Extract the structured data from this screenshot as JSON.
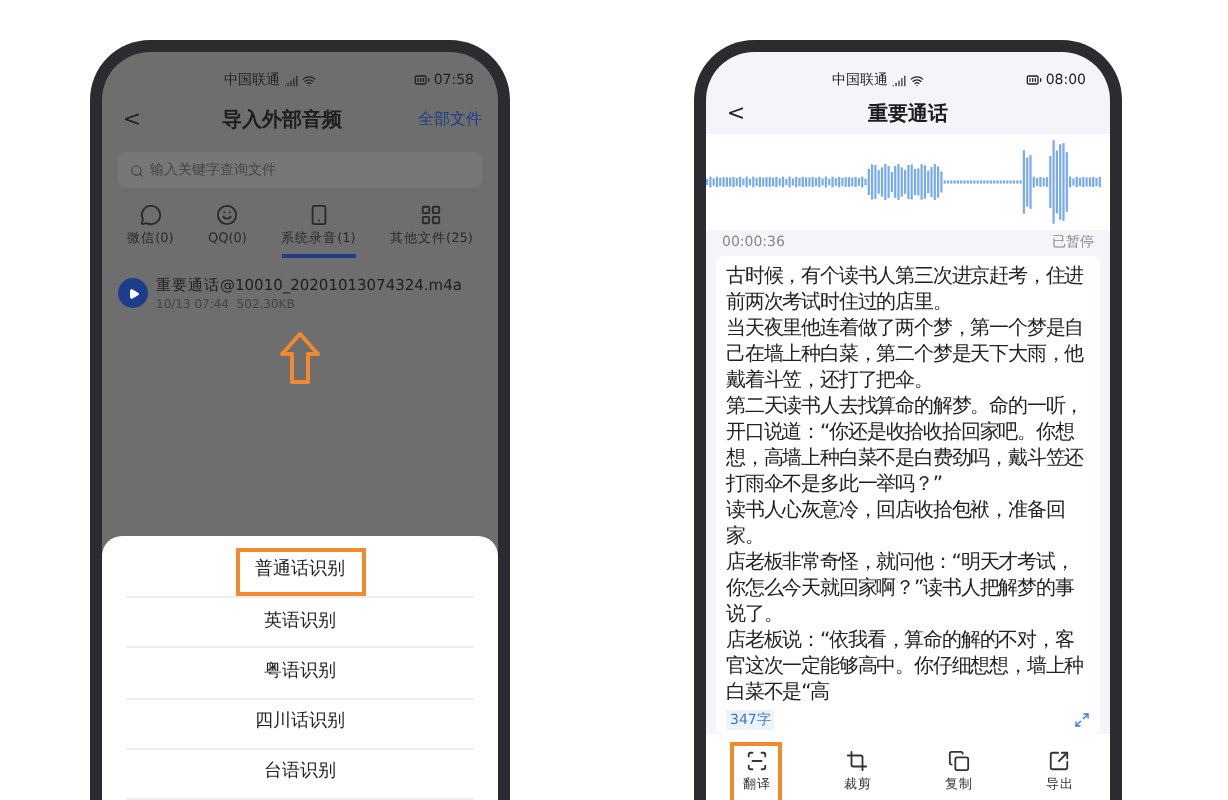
{
  "left_phone": {
    "status_bar": {
      "carrier": "中国联通",
      "time": "07:58"
    },
    "header": {
      "back": "<",
      "title": "导入外部音频",
      "action": "全部文件"
    },
    "search": {
      "placeholder": "输入关键字查询文件"
    },
    "tabs": [
      {
        "label": "微信(0)",
        "selected": false
      },
      {
        "label": "QQ(0)",
        "selected": false
      },
      {
        "label": "系统录音(1)",
        "selected": true
      },
      {
        "label": "其他文件(25)",
        "selected": false
      }
    ],
    "files": [
      {
        "name": "重要通话@10010_20201013074324.m4a",
        "meta": "10/13 07:44  502.30KB"
      }
    ],
    "sheet": [
      {
        "label": "普通话识别",
        "highlighted": true
      },
      {
        "label": "英语识别",
        "highlighted": false
      },
      {
        "label": "粤语识别",
        "highlighted": false
      },
      {
        "label": "四川话识别",
        "highlighted": false
      },
      {
        "label": "台语识别",
        "highlighted": false
      }
    ]
  },
  "right_phone": {
    "status_bar": {
      "carrier": "中国联通",
      "time": "08:00"
    },
    "header": {
      "back": "<",
      "title": "重要通话"
    },
    "player": {
      "time": "00:00:36",
      "state": "已暂停"
    },
    "paragraphs": [
      "古时候，有个读书人第三次进京赶考，住进前两次考试时住过的店里。",
      "当天夜里他连着做了两个梦，第一个梦是自己在墙上种白菜，第二个梦是天下大雨，他戴着斗笠，还打了把伞。",
      "第二天读书人去找算命的解梦。命的一听，开口说道：“你还是收拾收拾回家吧。你想想，高墙上种白菜不是白费劲吗，戴斗笠还打雨伞不是多此一举吗？”",
      "读书人心灰意冷，回店收拾包袱，准备回家。",
      "店老板非常奇怪，就问他：“明天才考试，你怎么今天就回家啊？”读书人把解梦的事说了。",
      "店老板说：“依我看，算命的解的不对，客官这次一定能够高中。你仔细想想，墙上种白菜不是“高"
    ],
    "word_count": "347字",
    "toolbar": [
      {
        "label": "翻译",
        "kind": "translate",
        "highlighted": true
      },
      {
        "label": "裁剪",
        "kind": "crop",
        "highlighted": false
      },
      {
        "label": "复制",
        "kind": "copy",
        "highlighted": false
      },
      {
        "label": "导出",
        "kind": "export",
        "highlighted": false
      }
    ]
  }
}
